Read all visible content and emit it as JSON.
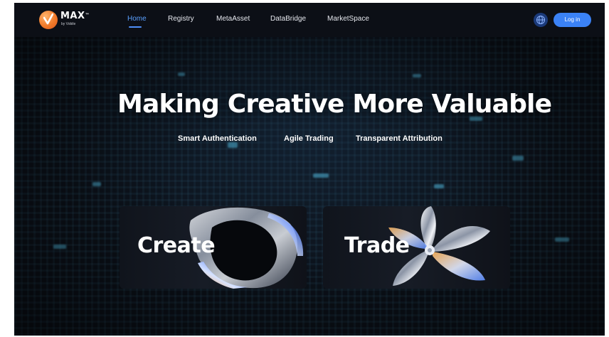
{
  "header": {
    "brand": "MAX",
    "brand_tm": "™",
    "brand_sub": "by Vobile",
    "nav": [
      {
        "label": "Home",
        "active": true
      },
      {
        "label": "Registry"
      },
      {
        "label": "MetaAsset"
      },
      {
        "label": "DataBridge"
      },
      {
        "label": "MarketSpace"
      }
    ],
    "language_icon": "globe-icon",
    "login_label": "Log in"
  },
  "hero": {
    "title": "Making Creative More Valuable",
    "title_tm": "™",
    "taglines": [
      "Smart Authentication",
      "Agile Trading",
      "Transparent Attribution"
    ]
  },
  "cards": [
    {
      "label": "Create"
    },
    {
      "label": "Trade"
    }
  ],
  "colors": {
    "accent": "#3b82f6",
    "active_nav": "#5aa0ff",
    "logo_orange": "#f07a2a",
    "background": "#0b1018"
  }
}
